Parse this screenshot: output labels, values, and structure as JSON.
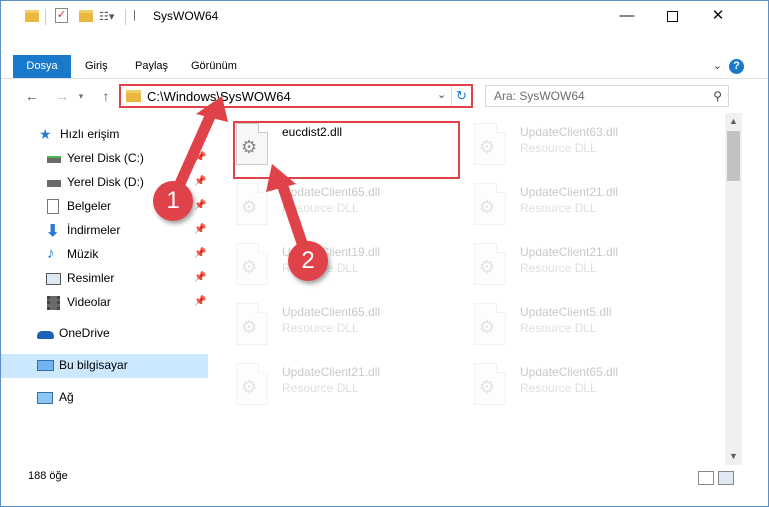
{
  "titlebar": {
    "title": "SysWOW64",
    "minimize_icon": "minimize-icon",
    "maximize_icon": "maximize-icon",
    "close_icon": "close-icon"
  },
  "ribbon": {
    "tabs": [
      {
        "label": "Dosya"
      },
      {
        "label": "Giriş"
      },
      {
        "label": "Paylaş"
      },
      {
        "label": "Görünüm"
      }
    ],
    "help": "?",
    "file_tab_color": "#1979ca"
  },
  "navbar": {
    "address": "C:\\Windows\\SysWOW64",
    "search_placeholder": "Ara: SysWOW64"
  },
  "sidebar": {
    "items": [
      {
        "label": "Hızlı erişim",
        "icon": "star-icon"
      },
      {
        "label": "Yerel Disk (C:)",
        "icon": "drive-icon",
        "pinned": true
      },
      {
        "label": "Yerel Disk (D:)",
        "icon": "drive-icon",
        "pinned": true
      },
      {
        "label": "Belgeler",
        "icon": "documents-icon",
        "pinned": true
      },
      {
        "label": "İndirmeler",
        "icon": "download-icon",
        "pinned": true
      },
      {
        "label": "Müzik",
        "icon": "music-icon",
        "pinned": true
      },
      {
        "label": "Resimler",
        "icon": "pictures-icon",
        "pinned": true
      },
      {
        "label": "Videolar",
        "icon": "videos-icon",
        "pinned": true
      },
      {
        "label": "OneDrive",
        "icon": "cloud-icon"
      },
      {
        "label": "Bu bilgisayar",
        "icon": "computer-icon",
        "selected": true
      },
      {
        "label": "Ağ",
        "icon": "network-icon"
      }
    ]
  },
  "files": {
    "highlighted": {
      "name": "eucdist2.dll"
    },
    "left_column": [
      {
        "name": "UpdateClient65.dll",
        "type": "Resource DLL"
      },
      {
        "name": "UpdateClient19.dll",
        "type": "Resource DLL"
      },
      {
        "name": "UpdateClient65.dll",
        "type": "Resource DLL"
      },
      {
        "name": "UpdateClient21.dll",
        "type": "Resource DLL"
      }
    ],
    "right_column": [
      {
        "name": "UpdateClient63.dll",
        "type": "Resource DLL"
      },
      {
        "name": "UpdateClient21.dll",
        "type": "Resource DLL"
      },
      {
        "name": "UpdateClient21.dll",
        "type": "Resource DLL"
      },
      {
        "name": "UpdateClient5.dll",
        "type": "Resource DLL"
      },
      {
        "name": "UpdateClient65.dll",
        "type": "Resource DLL"
      }
    ]
  },
  "statusbar": {
    "count": "188 öğe"
  },
  "annotations": {
    "step1": "1",
    "step2": "2",
    "color": "#e0424a"
  }
}
